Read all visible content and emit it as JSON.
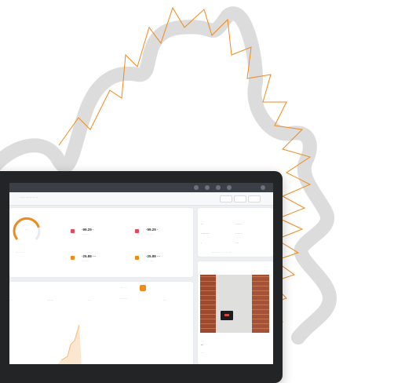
{
  "colors": {
    "accent": "#f08a1c",
    "ribbon": "#dcdcdc",
    "frame": "#232425",
    "topbar": "#3b3f46"
  },
  "header": {
    "breadcrumb": "··· ······· ·· ··",
    "window_icons": [
      "grid-icon",
      "bell-icon",
      "settings-icon",
      "user-icon",
      "menu-icon"
    ]
  },
  "gauge": {
    "center_value": "···",
    "caption": "··· ····",
    "level": 0.78
  },
  "stats": [
    {
      "value": "·99.29 ·",
      "label": "··· ····"
    },
    {
      "value": "·99.29 ·",
      "label": "··· ····"
    },
    {
      "value": "·25.88 ···",
      "label": "··· ····"
    },
    {
      "value": "·25.88 ···",
      "label": "··· ····"
    }
  ],
  "info": {
    "items": [
      "··",
      "······",
      "········",
      "······",
      "·",
      "···"
    ],
    "footer": "··· ········ ·· ·· ···"
  },
  "chart_panel": {
    "filter": "······",
    "columns": [
      "···",
      "·······",
      "····",
      "·········",
      "···"
    ]
  },
  "photo_caption": {
    "title": "··",
    "line": "····"
  }
}
